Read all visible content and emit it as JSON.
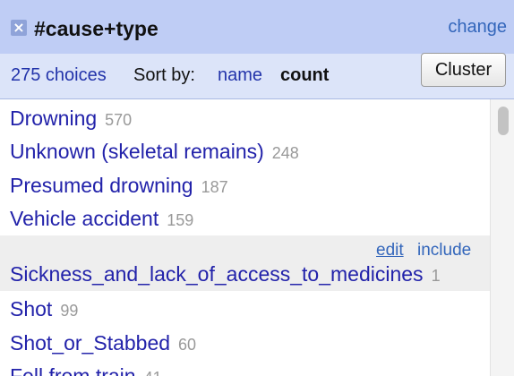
{
  "facet": {
    "title": "#cause+type",
    "close_icon": "×",
    "change_label": "change",
    "choice_count": "275 choices",
    "sort_by_label": "Sort by:",
    "sort_name": "name",
    "sort_count": "count",
    "cluster_button": "Cluster"
  },
  "choices": [
    {
      "label": "Drowning",
      "count": "570"
    },
    {
      "label": "Unknown (skeletal remains)",
      "count": "248"
    },
    {
      "label": "Presumed drowning",
      "count": "187"
    },
    {
      "label": "Vehicle accident",
      "count": "159"
    },
    {
      "label": "Sickness_and_lack_of_access_to_medicines",
      "count": "1"
    },
    {
      "label": "Shot",
      "count": "99"
    },
    {
      "label": "Shot_or_Stabbed",
      "count": "60"
    },
    {
      "label": "Fell from train",
      "count": "41"
    }
  ],
  "hover_actions": {
    "edit": "edit",
    "include": "include"
  }
}
